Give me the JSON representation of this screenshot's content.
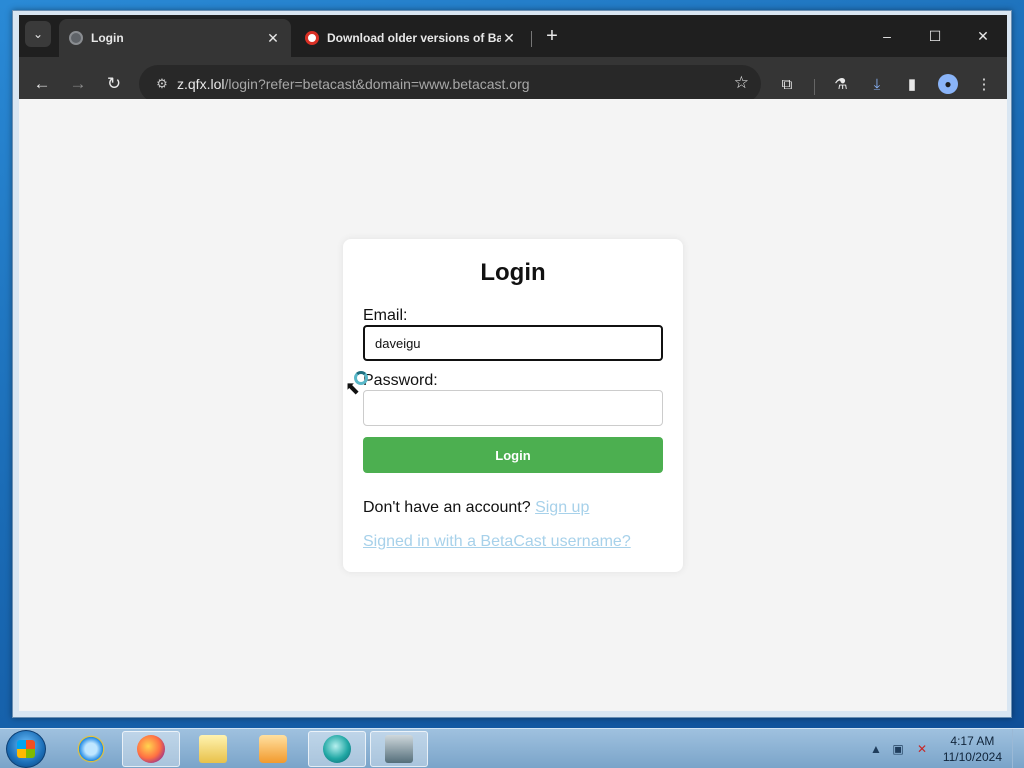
{
  "browser": {
    "tabs": [
      {
        "title": "Login",
        "active": true
      },
      {
        "title": "Download older versions of Ba",
        "active": false
      }
    ],
    "new_tab_icon": "plus-icon",
    "window_controls": {
      "minimize": "–",
      "maximize": "☐",
      "close": "✕"
    },
    "url": {
      "host": "z.qfx.lol",
      "path": "/login?refer=betacast&domain=www.betacast.org"
    }
  },
  "page": {
    "title": "Login",
    "email_label": "Email:",
    "email_value": "daveigu",
    "password_label": "Password:",
    "password_value": "",
    "login_button": "Login",
    "signup_prompt": "Don't have an account?",
    "signup_link": "Sign up",
    "username_link": "Signed in with a BetaCast username?"
  },
  "taskbar": {
    "time": "4:17 AM",
    "date": "11/10/2024"
  },
  "colors": {
    "button": "#4caf50",
    "link": "#a7d1ea",
    "chrome_dark": "#1f1f1f"
  }
}
